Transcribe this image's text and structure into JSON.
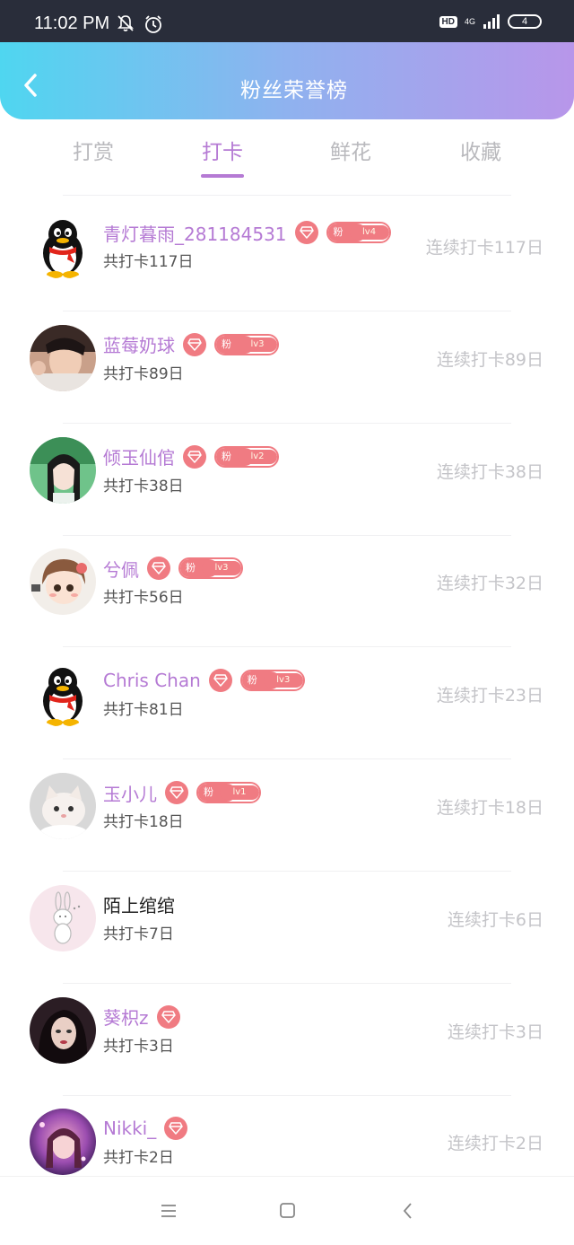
{
  "status_bar": {
    "time": "11:02 PM",
    "icons": [
      "bell-off-icon",
      "alarm-icon"
    ],
    "hd_label": "HD",
    "network_label": "4G",
    "battery": "4"
  },
  "header": {
    "title": "粉丝荣誉榜",
    "back_icon": "chevron-left-icon"
  },
  "tabs": [
    {
      "label": "打赏",
      "active": false
    },
    {
      "label": "打卡",
      "active": true
    },
    {
      "label": "鲜花",
      "active": false
    },
    {
      "label": "收藏",
      "active": false
    }
  ],
  "colors": {
    "accent": "#b57ad4",
    "badge": "#f07b82",
    "header_start": "#4fd6f0",
    "header_end": "#b896ea"
  },
  "fan_badge_label": "粉",
  "users": [
    {
      "name": "青灯暮雨_281184531",
      "total": "共打卡117日",
      "streak": "连续打卡117日",
      "diamond": true,
      "fan_level": "lv4",
      "avatar": "penguin",
      "name_plain": false
    },
    {
      "name": "蓝莓奶球",
      "total": "共打卡89日",
      "streak": "连续打卡89日",
      "diamond": true,
      "fan_level": "lv3",
      "avatar": "photo-boy",
      "name_plain": false
    },
    {
      "name": "倾玉仙倌",
      "total": "共打卡38日",
      "streak": "连续打卡38日",
      "diamond": true,
      "fan_level": "lv2",
      "avatar": "photo-costume",
      "name_plain": false
    },
    {
      "name": "兮佩",
      "total": "共打卡56日",
      "streak": "连续打卡32日",
      "diamond": true,
      "fan_level": "lv3",
      "avatar": "anime-girl",
      "name_plain": false
    },
    {
      "name": "Chris Chan",
      "total": "共打卡81日",
      "streak": "连续打卡23日",
      "diamond": true,
      "fan_level": "lv3",
      "avatar": "penguin",
      "name_plain": false
    },
    {
      "name": "玉小儿",
      "total": "共打卡18日",
      "streak": "连续打卡18日",
      "diamond": true,
      "fan_level": "lv1",
      "avatar": "kitten",
      "name_plain": false
    },
    {
      "name": "陌上绾绾",
      "total": "共打卡7日",
      "streak": "连续打卡6日",
      "diamond": false,
      "fan_level": null,
      "avatar": "bunny-sketch",
      "name_plain": true
    },
    {
      "name": "葵枳z",
      "total": "共打卡3日",
      "streak": "连续打卡3日",
      "diamond": true,
      "fan_level": null,
      "avatar": "illustration-girl",
      "name_plain": false
    },
    {
      "name": "Nikki_",
      "total": "共打卡2日",
      "streak": "连续打卡2日",
      "diamond": true,
      "fan_level": null,
      "avatar": "photo-purple",
      "name_plain": false
    }
  ],
  "nav_bar": {
    "buttons": [
      "menu-icon",
      "home-icon",
      "back-icon"
    ]
  }
}
